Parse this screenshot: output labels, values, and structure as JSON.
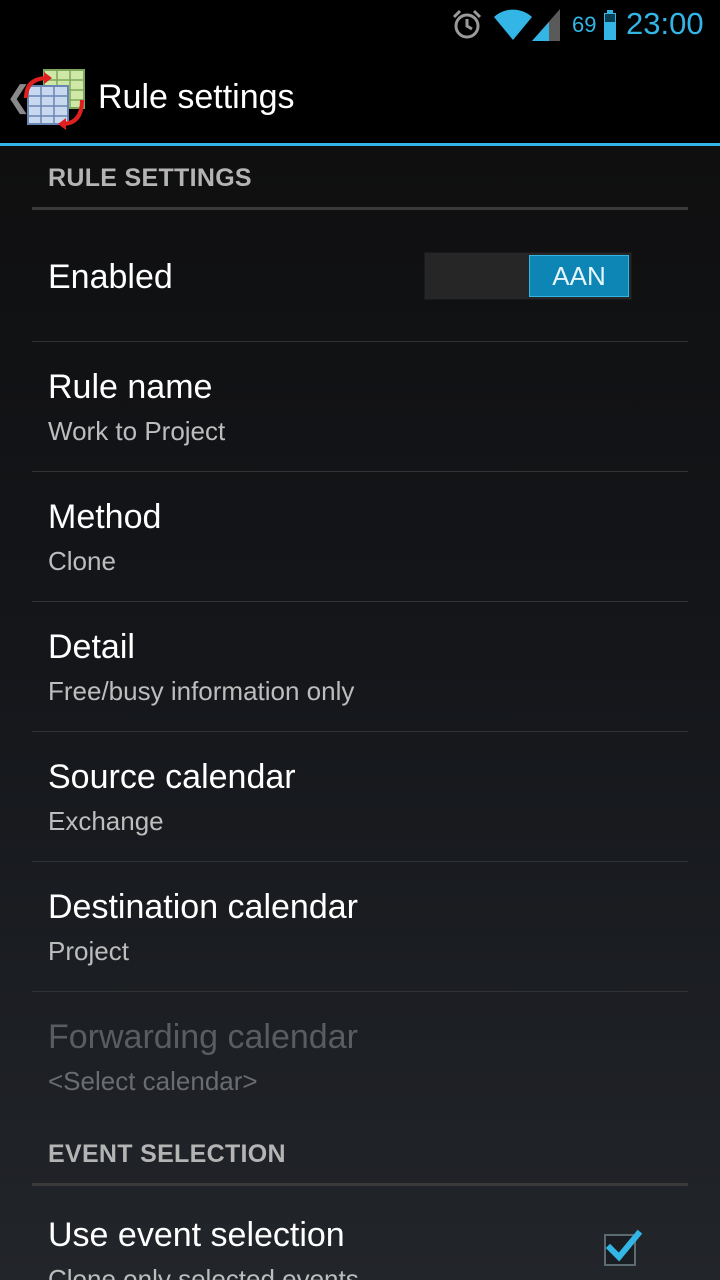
{
  "status_bar": {
    "battery_level": "69",
    "time": "23:00",
    "icons": [
      "alarm-icon",
      "wifi-icon",
      "signal-icon",
      "battery-icon"
    ],
    "accent_color": "#33b5e5"
  },
  "action_bar": {
    "title": "Rule settings",
    "icon": "calendar-sync-app-icon"
  },
  "sections": {
    "rule_settings_header": "RULE SETTINGS",
    "event_selection_header": "EVENT SELECTION"
  },
  "prefs": {
    "enabled": {
      "title": "Enabled",
      "toggle_label": "AAN",
      "checked": true
    },
    "rule_name": {
      "title": "Rule name",
      "summary": "Work to Project"
    },
    "method": {
      "title": "Method",
      "summary": "Clone"
    },
    "detail": {
      "title": "Detail",
      "summary": "Free/busy information only"
    },
    "source_calendar": {
      "title": "Source calendar",
      "summary": "Exchange"
    },
    "destination_calendar": {
      "title": "Destination calendar",
      "summary": "Project"
    },
    "forwarding_calendar": {
      "title": "Forwarding calendar",
      "summary": "<Select calendar>",
      "enabled": false
    },
    "use_event_selection": {
      "title": "Use event selection",
      "summary": "Clone only selected events",
      "checked": true
    }
  }
}
